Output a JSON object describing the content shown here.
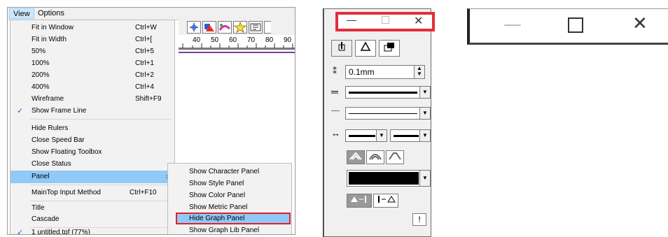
{
  "menubar": {
    "items": [
      "View",
      "Options"
    ]
  },
  "view_menu": {
    "items": [
      {
        "label": "Fit in Window",
        "shortcut": "Ctrl+W"
      },
      {
        "label": "Fit in Width",
        "shortcut": "Ctrl+["
      },
      {
        "label": "50%",
        "shortcut": "Ctrl+5"
      },
      {
        "label": "100%",
        "shortcut": "Ctrl+1"
      },
      {
        "label": "200%",
        "shortcut": "Ctrl+2"
      },
      {
        "label": "400%",
        "shortcut": "Ctrl+4"
      },
      {
        "label": "Wireframe",
        "shortcut": "Shift+F9"
      },
      {
        "label": "Show Frame Line",
        "shortcut": ""
      },
      {
        "label": "Hide Rulers",
        "shortcut": ""
      },
      {
        "label": "Close Speed Bar",
        "shortcut": ""
      },
      {
        "label": "Show Floating Toolbox",
        "shortcut": ""
      },
      {
        "label": "Close Status",
        "shortcut": ""
      },
      {
        "label": "Panel",
        "shortcut": ""
      },
      {
        "label": "MainTop Input Method",
        "shortcut": "Ctrl+F10"
      },
      {
        "label": "Title",
        "shortcut": ""
      },
      {
        "label": "Cascade",
        "shortcut": ""
      },
      {
        "label": "1 untitled.tpf (77%)",
        "shortcut": ""
      }
    ]
  },
  "panel_submenu": {
    "items": [
      "Show Character Panel",
      "Show Style Panel",
      "Show Color Panel",
      "Show Metric Panel",
      "Hide Graph Panel",
      "Show Graph Lib Panel"
    ]
  },
  "ruler": {
    "numbers": [
      "40",
      "50",
      "60",
      "70",
      "80",
      "90"
    ]
  },
  "graph_panel": {
    "line_width_value": "0.1mm",
    "info_button": "!"
  },
  "icons": {
    "check": "checkmark-icon",
    "submenu_arrow": "chevron-right-icon",
    "minimize": "minimize-icon",
    "maximize": "maximize-icon",
    "close": "close-icon"
  },
  "colors": {
    "highlight": "#91c9f7",
    "annotation_red": "#e32e3a",
    "fill_black": "#000000"
  }
}
